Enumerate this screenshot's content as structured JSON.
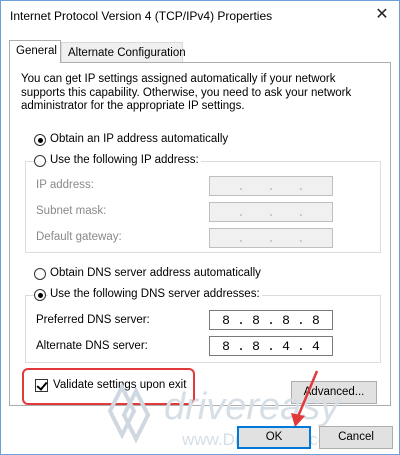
{
  "window": {
    "title": "Internet Protocol Version 4 (TCP/IPv4) Properties",
    "close_glyph": "✕"
  },
  "tabs": [
    {
      "label": "General",
      "active": true
    },
    {
      "label": "Alternate Configuration",
      "active": false
    }
  ],
  "description": "You can get IP settings assigned automatically if your network supports this capability. Otherwise, you need to ask your network administrator for the appropriate IP settings.",
  "ip_section": {
    "auto_label": "Obtain an IP address automatically",
    "auto_selected": true,
    "manual_label": "Use the following IP address:",
    "manual_selected": false,
    "fields": [
      {
        "label": "IP address:",
        "octets": [
          "",
          "",
          "",
          ""
        ],
        "disabled": true
      },
      {
        "label": "Subnet mask:",
        "octets": [
          "",
          "",
          "",
          ""
        ],
        "disabled": true
      },
      {
        "label": "Default gateway:",
        "octets": [
          "",
          "",
          "",
          ""
        ],
        "disabled": true
      }
    ]
  },
  "dns_section": {
    "auto_label": "Obtain DNS server address automatically",
    "auto_selected": false,
    "manual_label": "Use the following DNS server addresses:",
    "manual_selected": true,
    "fields": [
      {
        "label": "Preferred DNS server:",
        "octets": [
          "8",
          "8",
          "8",
          "8"
        ]
      },
      {
        "label": "Alternate DNS server:",
        "octets": [
          "8",
          "8",
          "4",
          "4"
        ]
      }
    ]
  },
  "validate": {
    "label": "Validate settings upon exit",
    "checked": true
  },
  "buttons": {
    "advanced": "Advanced...",
    "ok": "OK",
    "cancel": "Cancel"
  },
  "watermark": {
    "brand": "drivereasy",
    "url": "www.DriverEasy.com"
  },
  "colors": {
    "highlight": "#e23a3a",
    "focus_border": "#0078d7",
    "watermark": "#cfd8e0"
  }
}
